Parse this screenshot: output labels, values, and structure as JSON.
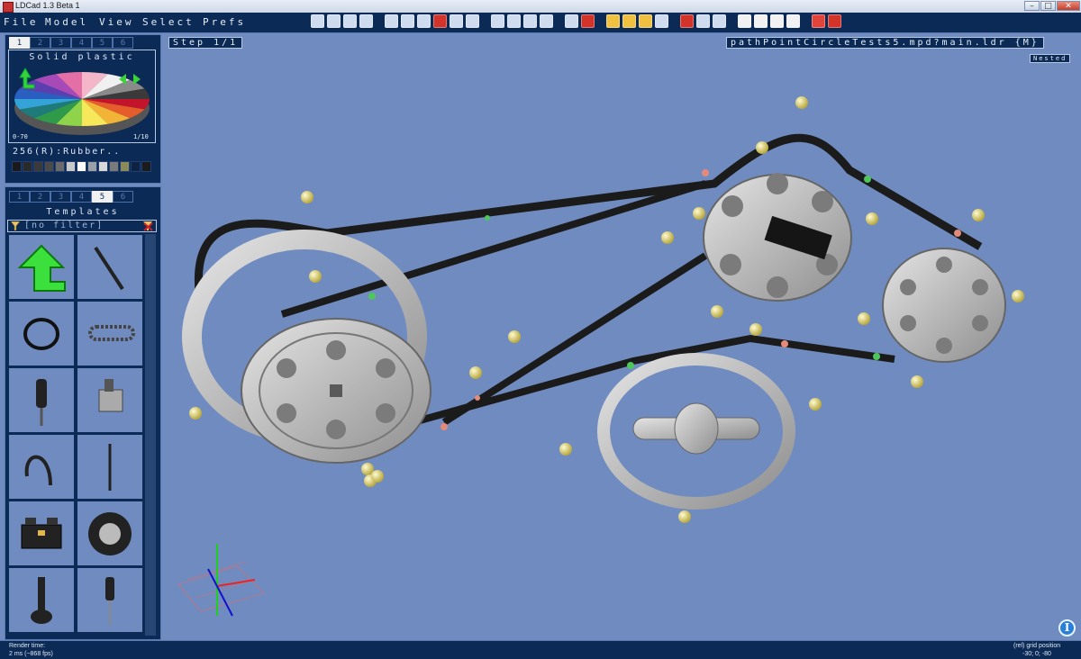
{
  "window": {
    "title": "LDCad 1.3 Beta 1"
  },
  "menu": [
    "File",
    "Model",
    "View",
    "Select",
    "Prefs"
  ],
  "toolbar": {
    "icons": [
      "new-file-icon",
      "open-file-icon",
      "save-icon",
      "save-all-icon",
      "undo-icon",
      "redo-icon",
      "copy-icon",
      "cut-icon",
      "paste-icon",
      "paste-special-icon",
      "nav-first-icon",
      "nav-prev-icon",
      "nav-next-icon",
      "nav-last-icon",
      "add-step-icon",
      "delete-step-icon",
      "color-wheel-icon",
      "color-pick-icon",
      "grid-icon",
      "snap-icon",
      "hide-icon",
      "show-icon",
      "isolate-icon",
      "move-icon",
      "rotate-icon",
      "rotate-center-icon",
      "spread-icon",
      "favorite-add-icon",
      "favorite-remove-icon"
    ]
  },
  "colorPanel": {
    "tabs": [
      "1",
      "2",
      "3",
      "4",
      "5",
      "6"
    ],
    "activeTab": "1",
    "title": "Solid plastic",
    "rangeLeft": "0-70",
    "rangeRight": "1/10",
    "currentColor": "256(R):Rubber..",
    "swatches": [
      "#1a1a1a",
      "#2a2a2a",
      "#3a3a3a",
      "#4a4a4a",
      "#6a6a6a",
      "#c9c9c9",
      "#ffffff",
      "#9aa0a8",
      "#d8d8d8",
      "#7a7a7a",
      "#8a8a5a",
      "#0e2244",
      "#1b1b1b"
    ],
    "pieColors": [
      "#c2152b",
      "#e45d2a",
      "#f2b437",
      "#f6e85a",
      "#8ed34a",
      "#2f9a4a",
      "#1f7a7a",
      "#33a3d8",
      "#2a5fc2",
      "#5b3fb0",
      "#a74ab8",
      "#e46fa6",
      "#f3b7c9",
      "#f0f0f0",
      "#8a8a8a",
      "#3a3a3a"
    ]
  },
  "templatesPanel": {
    "tabs": [
      "1",
      "2",
      "3",
      "4",
      "5",
      "6"
    ],
    "activeTab": "5",
    "title": "Templates",
    "filter": "[no filter]",
    "items": [
      "green-arrow-template",
      "flex-axle-template",
      "rubber-band-template",
      "chain-template",
      "pneumatic-cylinder-template",
      "pneumatic-switch-template",
      "pneumatic-hose-template",
      "string-template",
      "brick-template",
      "tire-wheel-template",
      "lever-template",
      "shock-absorber-template"
    ]
  },
  "viewport": {
    "step": "Step 1/1",
    "file": "pathPointCircleTests5.mpd?main.ldr {M}",
    "nested": "Nested"
  },
  "status": {
    "renderLabel": "Render time:",
    "renderValue": "2 ms (~868 fps)",
    "gridLabel": "(rel) grid position",
    "gridValue": "-30; 0; -80"
  }
}
